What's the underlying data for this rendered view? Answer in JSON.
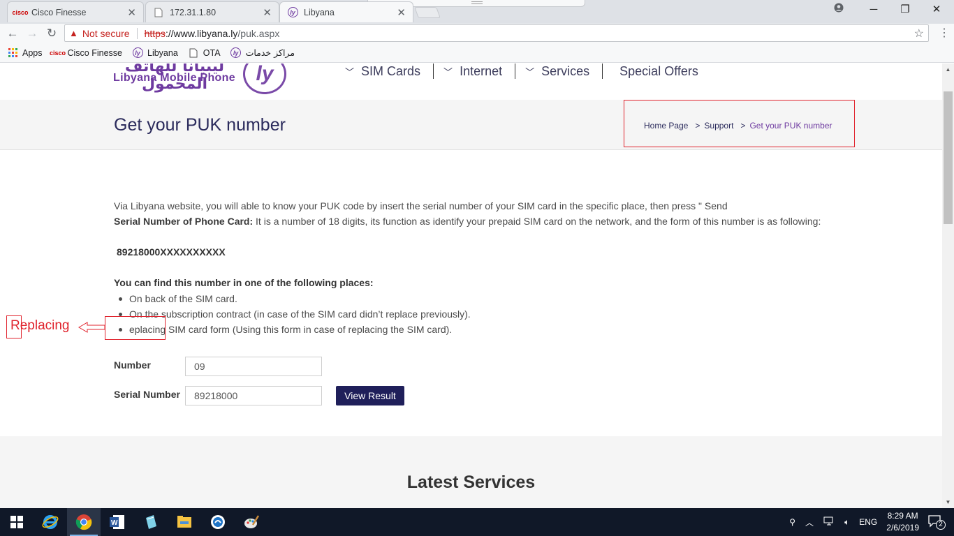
{
  "browser": {
    "tabs": [
      {
        "label": "Cisco Finesse",
        "icon": "cisco-icon"
      },
      {
        "label": "172.31.1.80",
        "icon": "page-icon"
      },
      {
        "label": "Libyana",
        "icon": "libyana-icon",
        "active": true
      }
    ],
    "address": {
      "security": "Not secure",
      "protocol": "https",
      "host": "://www.libyana.ly",
      "path": "/puk.aspx"
    },
    "bookmarks": [
      {
        "label": "Apps",
        "icon": "apps-grid-icon"
      },
      {
        "label": "Cisco Finesse",
        "icon": "cisco-icon"
      },
      {
        "label": "Libyana",
        "icon": "libyana-icon"
      },
      {
        "label": "OTA",
        "icon": "page-icon"
      },
      {
        "label": "مراكز خدمات",
        "icon": "libyana-icon"
      }
    ]
  },
  "site": {
    "logo_ar": "ليبيانا للهاتف المحمول",
    "logo_en": "Libyana Mobile Phone",
    "nav": [
      {
        "label": "SIM Cards",
        "has_dropdown": true
      },
      {
        "label": "Internet",
        "has_dropdown": true
      },
      {
        "label": "Services",
        "has_dropdown": true
      },
      {
        "label": "Special Offers",
        "has_dropdown": false
      }
    ],
    "page_title": "Get your PUK number",
    "breadcrumb": {
      "home": "Home Page",
      "sep": ">",
      "support": "Support",
      "current": "Get your PUK number"
    }
  },
  "content": {
    "intro": "Via Libyana website, you will able to know your PUK code by insert the serial number of your SIM card in the specific place, then press \" Send",
    "serial_heading": "Serial Number of Phone Card:",
    "serial_desc": " It is a number of 18 digits, its function as identify your prepaid SIM card on the network, and the form of this number is as following:",
    "serial_example": "89218000XXXXXXXXXX",
    "places_heading": "You can find this number in one of the following places:",
    "places": [
      "On back of the SIM card.",
      "On the subscription contract (in case of the SIM card didn’t replace previously).",
      "eplacing SIM card form (Using this form in case of replacing the SIM card)."
    ],
    "annotation": "Replacing"
  },
  "form": {
    "number_label": "Number",
    "number_value": "09",
    "serial_label": "Serial Number",
    "serial_value": "89218000",
    "submit_label": "View Result"
  },
  "latest": {
    "title": "Latest Services"
  },
  "taskbar": {
    "apps": [
      "windows-start-icon",
      "internet-explorer-icon",
      "chrome-icon",
      "word-icon",
      "notepad-icon",
      "file-explorer-icon",
      "messenger-icon",
      "paint-icon"
    ],
    "language": "ENG",
    "time": "8:29 AM",
    "date": "2/6/2019",
    "notifications": "2"
  },
  "colors": {
    "brand_purple": "#6e3aa0",
    "navy": "#1f1f5a",
    "annotation_red": "#e0232d"
  }
}
